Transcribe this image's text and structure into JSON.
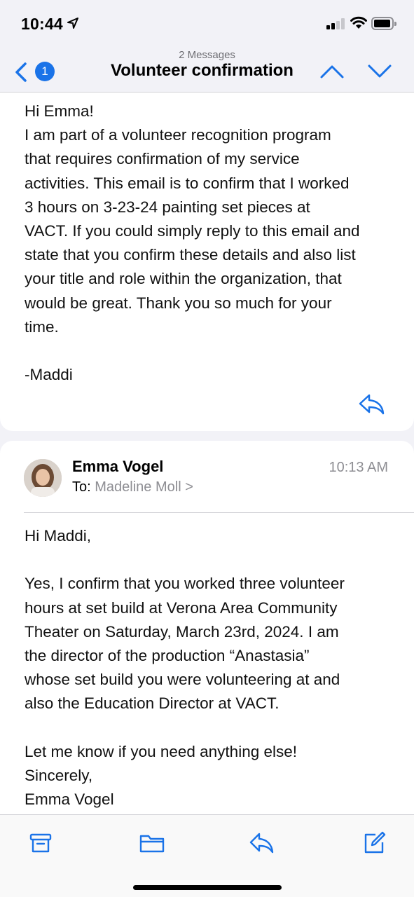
{
  "status": {
    "time": "10:44"
  },
  "nav": {
    "subtitle": "2 Messages",
    "title": "Volunteer confirmation",
    "back_count": "1"
  },
  "message1": {
    "lines": [
      "Hi Emma!",
      "I am part of a volunteer recognition program",
      "that requires confirmation of my service",
      "activities. This email is to confirm that I worked",
      "3 hours on 3-23-24 painting set pieces at",
      "VACT. If you could simply reply to this email and",
      "state that you confirm these details and also list",
      "your title and role within the organization, that",
      "would be great. Thank you so much for your",
      "time.",
      "",
      "-Maddi"
    ]
  },
  "message2": {
    "sender": "Emma Vogel",
    "to_label": "To:",
    "to_name": "Madeline Moll >",
    "time": "10:13 AM",
    "lines": [
      "Hi Maddi,",
      "",
      "Yes, I confirm that you worked three volunteer",
      "hours at set build at Verona Area Community",
      "Theater on Saturday, March 23rd, 2024. I am",
      "the director of the production “Anastasia”",
      "whose set build you were volunteering at and",
      "also the Education Director at VACT.",
      "",
      "Let me know if you need anything else!",
      "Sincerely,",
      "Emma Vogel"
    ]
  },
  "colors": {
    "accent": "#1a73e8",
    "secondary": "#8e8e93",
    "background": "#f2f2f7"
  },
  "icons": {
    "toolbar": [
      "archive-icon",
      "folder-icon",
      "reply-icon",
      "compose-icon"
    ]
  }
}
